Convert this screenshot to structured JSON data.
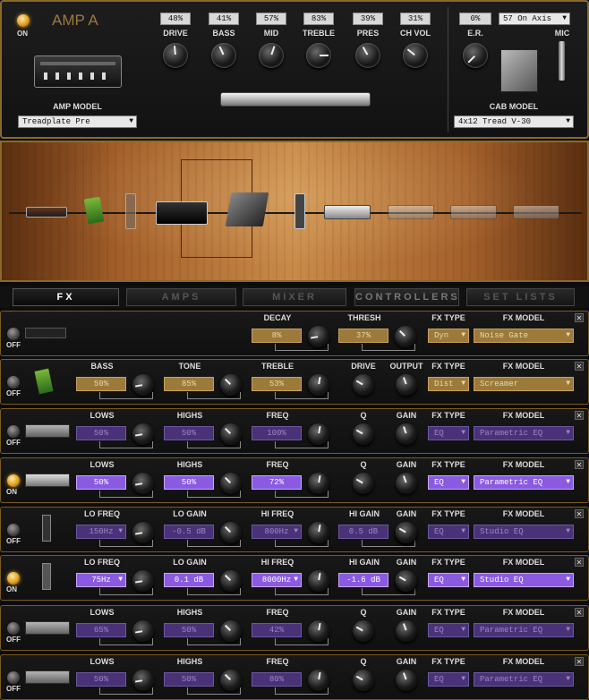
{
  "amp": {
    "power": "ON",
    "title": "AMP A",
    "model_label": "AMP MODEL",
    "model_value": "Treadplate Pre",
    "knobs": [
      {
        "label": "DRIVE",
        "value": "48%",
        "level": 0.48
      },
      {
        "label": "BASS",
        "value": "41%",
        "level": 0.41
      },
      {
        "label": "MID",
        "value": "57%",
        "level": 0.57
      },
      {
        "label": "TREBLE",
        "value": "83%",
        "level": 0.83
      },
      {
        "label": "PRES",
        "value": "39%",
        "level": 0.39
      },
      {
        "label": "CH VOL",
        "value": "31%",
        "level": 0.31
      }
    ],
    "er": {
      "label": "E.R.",
      "value": "0%",
      "level": 0.0
    },
    "mic": {
      "label": "MIC",
      "value": "57 On Axis"
    },
    "cab": {
      "label": "CAB MODEL",
      "value": "4x12 Tread V-30"
    }
  },
  "tabs": [
    "FX",
    "AMPS",
    "MIXER",
    "CONTROLLERS",
    "SET LISTS"
  ],
  "fx_rows": [
    {
      "state": "OFF",
      "icon": "noise-gate-icon",
      "params": [
        {
          "label": "DECAY",
          "value": "8%",
          "style": "tan"
        },
        {
          "label": "THRESH",
          "value": "37%",
          "style": "tan"
        }
      ],
      "fx_type_label": "FX TYPE",
      "fx_type": "Dyn",
      "fx_model_label": "FX MODEL",
      "fx_model": "Noise Gate",
      "mstyle": "tan"
    },
    {
      "state": "OFF",
      "icon": "screamer-pedal-icon",
      "params": [
        {
          "label": "BASS",
          "value": "50%",
          "style": "tan"
        },
        {
          "label": "TONE",
          "value": "85%",
          "style": "tan"
        },
        {
          "label": "TREBLE",
          "value": "53%",
          "style": "tan"
        }
      ],
      "extra": [
        "DRIVE",
        "OUTPUT"
      ],
      "fx_type_label": "FX TYPE",
      "fx_type": "Dist",
      "fx_model_label": "FX MODEL",
      "fx_model": "Screamer",
      "mstyle": "tan"
    },
    {
      "state": "OFF",
      "icon": "rack-eq-icon",
      "params": [
        {
          "label": "LOWS",
          "value": "50%",
          "style": "pur"
        },
        {
          "label": "HIGHS",
          "value": "50%",
          "style": "pur"
        },
        {
          "label": "FREQ",
          "value": "100%",
          "style": "pur"
        }
      ],
      "extra": [
        "Q",
        "GAIN"
      ],
      "fx_type_label": "FX TYPE",
      "fx_type": "EQ",
      "fx_model_label": "FX MODEL",
      "fx_model": "Parametric EQ",
      "mstyle": "pur"
    },
    {
      "state": "ON",
      "icon": "rack-eq-icon",
      "params": [
        {
          "label": "LOWS",
          "value": "50%",
          "style": "pur"
        },
        {
          "label": "HIGHS",
          "value": "50%",
          "style": "pur"
        },
        {
          "label": "FREQ",
          "value": "72%",
          "style": "pur"
        }
      ],
      "extra": [
        "Q",
        "GAIN"
      ],
      "fx_type_label": "FX TYPE",
      "fx_type": "EQ",
      "fx_model_label": "FX MODEL",
      "fx_model": "Parametric EQ",
      "mstyle": "pur"
    },
    {
      "state": "OFF",
      "icon": "studio-eq-icon",
      "params": [
        {
          "label": "LO FREQ",
          "value": "150Hz",
          "style": "pur",
          "dd": true
        },
        {
          "label": "LO GAIN",
          "value": "-0.5 dB",
          "style": "pur"
        },
        {
          "label": "HI FREQ",
          "value": "800Hz",
          "style": "pur",
          "dd": true
        },
        {
          "label": "HI GAIN",
          "value": "0.5 dB",
          "style": "pur"
        }
      ],
      "extra": [
        "GAIN"
      ],
      "fx_type_label": "FX TYPE",
      "fx_type": "EQ",
      "fx_model_label": "FX MODEL",
      "fx_model": "Studio EQ",
      "mstyle": "pur"
    },
    {
      "state": "ON",
      "icon": "studio-eq-icon",
      "params": [
        {
          "label": "LO FREQ",
          "value": "75Hz",
          "style": "pur",
          "dd": true
        },
        {
          "label": "LO GAIN",
          "value": "0.1 dB",
          "style": "pur"
        },
        {
          "label": "HI FREQ",
          "value": "8000Hz",
          "style": "pur",
          "dd": true
        },
        {
          "label": "HI GAIN",
          "value": "-1.6 dB",
          "style": "pur"
        }
      ],
      "extra": [
        "GAIN"
      ],
      "fx_type_label": "FX TYPE",
      "fx_type": "EQ",
      "fx_model_label": "FX MODEL",
      "fx_model": "Studio EQ",
      "mstyle": "pur"
    },
    {
      "state": "OFF",
      "icon": "rack-eq-icon",
      "params": [
        {
          "label": "LOWS",
          "value": "65%",
          "style": "pur"
        },
        {
          "label": "HIGHS",
          "value": "50%",
          "style": "pur"
        },
        {
          "label": "FREQ",
          "value": "42%",
          "style": "pur"
        }
      ],
      "extra": [
        "Q",
        "GAIN"
      ],
      "fx_type_label": "FX TYPE",
      "fx_type": "EQ",
      "fx_model_label": "FX MODEL",
      "fx_model": "Parametric EQ",
      "mstyle": "pur"
    },
    {
      "state": "OFF",
      "icon": "rack-eq-icon",
      "params": [
        {
          "label": "LOWS",
          "value": "50%",
          "style": "pur"
        },
        {
          "label": "HIGHS",
          "value": "50%",
          "style": "pur"
        },
        {
          "label": "FREQ",
          "value": "80%",
          "style": "pur"
        }
      ],
      "extra": [
        "Q",
        "GAIN"
      ],
      "fx_type_label": "FX TYPE",
      "fx_type": "EQ",
      "fx_model_label": "FX MODEL",
      "fx_model": "Parametric EQ",
      "mstyle": "pur"
    }
  ],
  "colors": {
    "accent": "#8a6a2a",
    "purple": "#8a5ae0",
    "tan": "#9b7a3a",
    "led_on": "#e0a020"
  }
}
